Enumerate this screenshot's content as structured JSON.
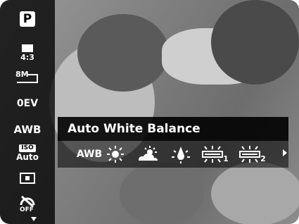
{
  "sidebar": {
    "mode_label": "P",
    "aspect_label": "4:3",
    "size_label": "8M",
    "ev_label": "0EV",
    "wb_label": "AWB",
    "iso_top": "ISO",
    "iso_bottom": "Auto",
    "flash_label": "OFF"
  },
  "menu": {
    "title": "Auto White Balance",
    "options": {
      "awb": "AWB",
      "fluorescent1_sub": "1",
      "fluorescent2_sub": "2"
    }
  },
  "colors": {
    "sidebar_bg": "#000000",
    "text": "#ffffff"
  },
  "icons": [
    "camera-mode-icon",
    "aspect-ratio-icon",
    "image-size-icon",
    "exposure-icon",
    "white-balance-icon",
    "iso-icon",
    "metering-icon",
    "flash-off-icon",
    "daylight-icon",
    "cloudy-icon",
    "tungsten-icon",
    "fluorescent-1-icon",
    "fluorescent-2-icon",
    "scroll-right-icon",
    "scroll-down-icon"
  ]
}
